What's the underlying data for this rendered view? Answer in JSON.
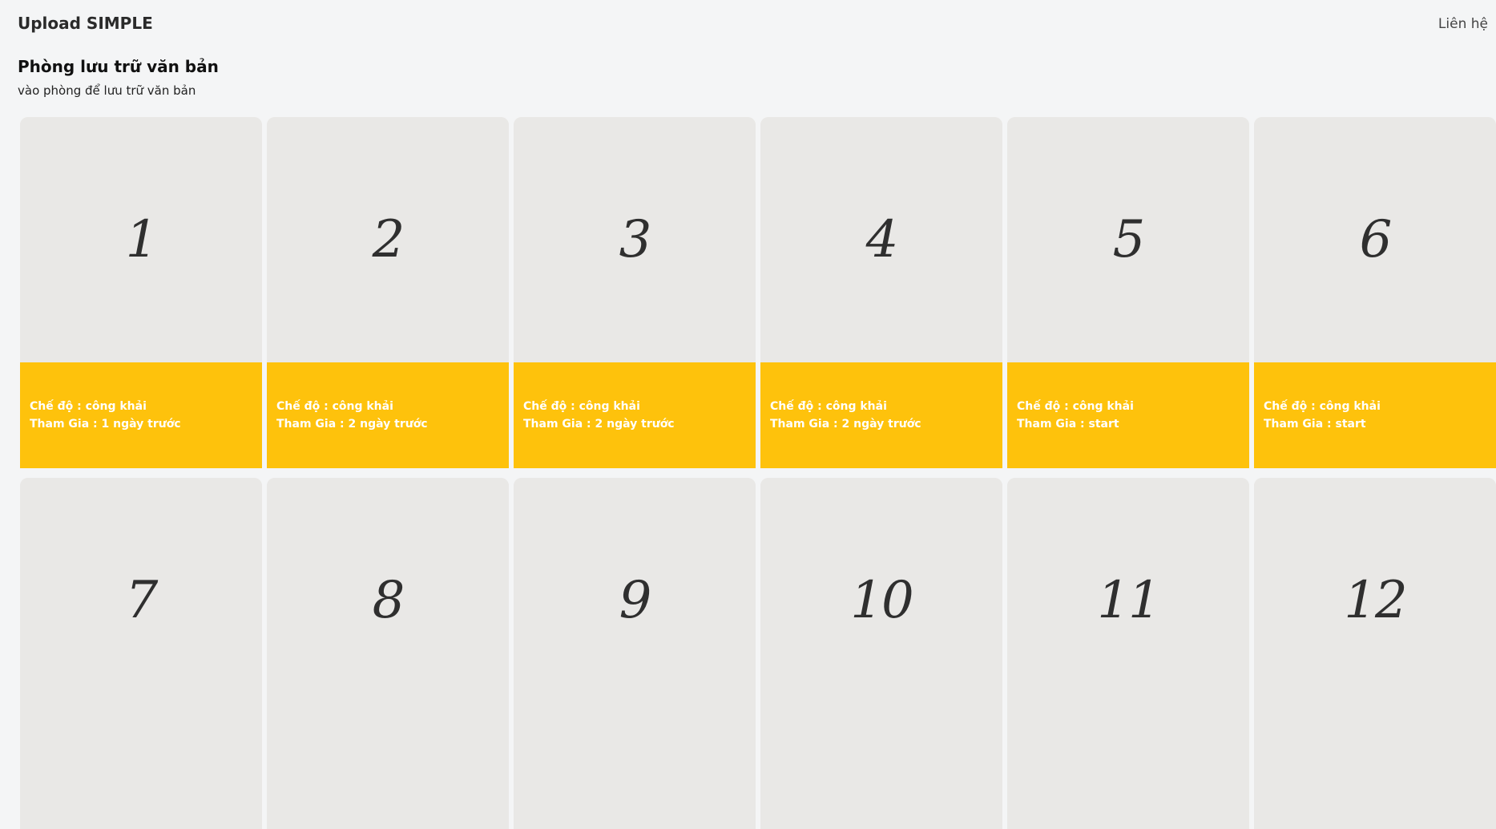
{
  "header": {
    "brand": "Upload SIMPLE",
    "contact": "Liên hệ"
  },
  "page": {
    "title": "Phòng lưu trữ văn bản",
    "subtitle": "vào phòng để lưu trữ văn bản"
  },
  "colors": {
    "background": "#f4f5f6",
    "card_top": "#e9e8e6",
    "card_bottom": "#fec20c",
    "card_text": "#ffffff"
  },
  "rooms": [
    {
      "number": "1",
      "mode": "Chế độ : công khải",
      "joined": "Tham Gia : 1 ngày trước"
    },
    {
      "number": "2",
      "mode": "Chế độ : công khải",
      "joined": "Tham Gia : 2 ngày trước"
    },
    {
      "number": "3",
      "mode": "Chế độ : công khải",
      "joined": "Tham Gia : 2 ngày trước"
    },
    {
      "number": "4",
      "mode": "Chế độ : công khải",
      "joined": "Tham Gia : 2 ngày trước"
    },
    {
      "number": "5",
      "mode": "Chế độ : công khải",
      "joined": "Tham Gia : start"
    },
    {
      "number": "6",
      "mode": "Chế độ : công khải",
      "joined": "Tham Gia : start"
    },
    {
      "number": "7"
    },
    {
      "number": "8"
    },
    {
      "number": "9"
    },
    {
      "number": "10"
    },
    {
      "number": "11"
    },
    {
      "number": "12"
    }
  ]
}
